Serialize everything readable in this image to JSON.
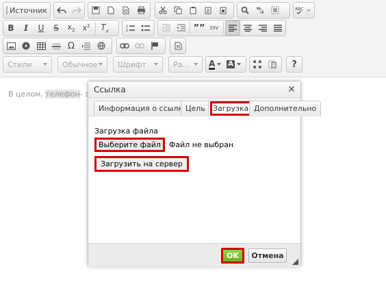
{
  "toolbar": {
    "source_label": "Источник",
    "styles_combo": "Стили",
    "format_combo": "Обычное",
    "font_combo": "Шрифт",
    "size_combo": "Ра...",
    "text_color_label": "A",
    "bg_color_label": "A",
    "help_label": "?",
    "blockquote_label": "””",
    "div_label": "DIV"
  },
  "editor": {
    "text_before": "В целом, ",
    "text_highlight": "телефон",
    "text_after": "- это"
  },
  "dialog": {
    "title": "Ссылка",
    "close_glyph": "✕",
    "tabs": [
      {
        "label": "Информация о ссылке"
      },
      {
        "label": "Цель"
      },
      {
        "label": "Загрузка"
      },
      {
        "label": "Дополнительно"
      }
    ],
    "active_tab": "Загрузка",
    "upload_label": "Загрузка файла",
    "choose_file_button": "Выберите файл",
    "file_status": "Файл не выбран",
    "upload_button": "Загрузить на сервер",
    "ok_button": "OK",
    "cancel_button": "Отмена"
  },
  "colors": {
    "highlight_red": "#d50000",
    "ok_green": "#7dbe2c",
    "toolbar_bg": "#f4f4f4"
  }
}
